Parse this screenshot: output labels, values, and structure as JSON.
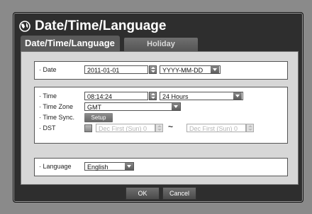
{
  "window": {
    "title": "Date/Time/Language"
  },
  "tabs": [
    {
      "label": "Date/Time/Language",
      "active": true
    },
    {
      "label": "Holiday",
      "active": false
    }
  ],
  "date_group": {
    "date_label": "· Date",
    "date_value": "2011-01-01",
    "date_format": "YYYY-MM-DD"
  },
  "time_group": {
    "time_label": "· Time",
    "time_value": "08:14:24",
    "time_format": "24 Hours",
    "timezone_label": "· Time Zone",
    "timezone_value": "GMT",
    "timesync_label": "· Time Sync.",
    "timesync_button": "Setup",
    "dst_label": "· DST",
    "dst_start": "Dec First (Sun) 0",
    "dst_separator": "~",
    "dst_end": "Dec First (Sun) 0"
  },
  "language_group": {
    "language_label": "· Language",
    "language_value": "English"
  },
  "footer": {
    "ok": "OK",
    "cancel": "Cancel"
  }
}
